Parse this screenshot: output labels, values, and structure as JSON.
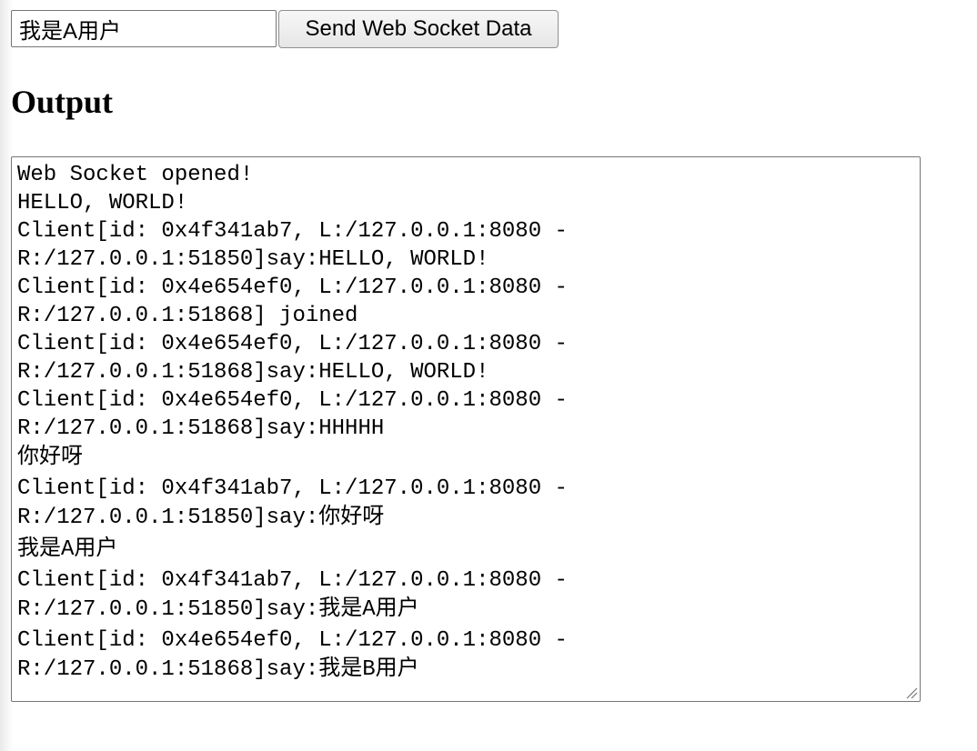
{
  "form": {
    "input_value": "我是A用户",
    "send_label": "Send Web Socket Data"
  },
  "output": {
    "heading": "Output",
    "lines": [
      "Web Socket opened!",
      "HELLO, WORLD!",
      "Client[id: 0x4f341ab7, L:/127.0.0.1:8080 -",
      "R:/127.0.0.1:51850]say:HELLO, WORLD!",
      "Client[id: 0x4e654ef0, L:/127.0.0.1:8080 -",
      "R:/127.0.0.1:51868] joined",
      "Client[id: 0x4e654ef0, L:/127.0.0.1:8080 -",
      "R:/127.0.0.1:51868]say:HELLO, WORLD!",
      "Client[id: 0x4e654ef0, L:/127.0.0.1:8080 -",
      "R:/127.0.0.1:51868]say:HHHHH",
      "你好呀",
      "Client[id: 0x4f341ab7, L:/127.0.0.1:8080 -",
      "R:/127.0.0.1:51850]say:你好呀",
      "我是A用户",
      "Client[id: 0x4f341ab7, L:/127.0.0.1:8080 -",
      "R:/127.0.0.1:51850]say:我是A用户",
      "Client[id: 0x4e654ef0, L:/127.0.0.1:8080 -",
      "R:/127.0.0.1:51868]say:我是B用户"
    ]
  }
}
